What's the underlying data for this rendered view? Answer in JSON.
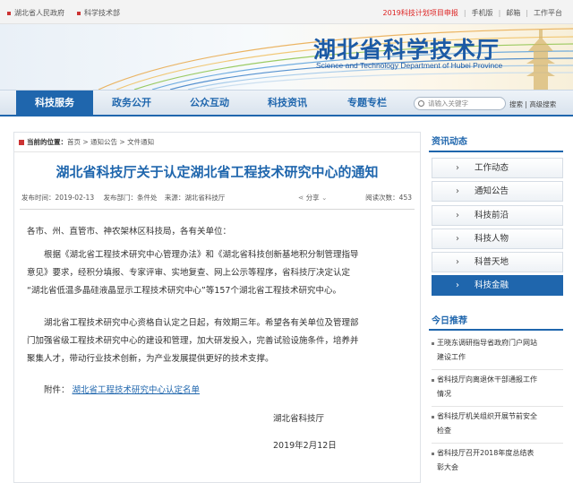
{
  "topbar": {
    "links_left": [
      "湖北省人民政府",
      "科学技术部"
    ],
    "notice": "2019科技计划项目申报",
    "links_right": [
      "手机版",
      "邮箱",
      "工作平台"
    ]
  },
  "banner": {
    "title": "湖北省科学技术厅",
    "subtitle": "Science and Technology Department of Hubei Province"
  },
  "nav": {
    "items": [
      "科技服务",
      "政务公开",
      "公众互动",
      "科技资讯",
      "专题专栏"
    ],
    "search_placeholder": "请输入关键字",
    "search_label": "搜索",
    "advanced_label": "高级搜索"
  },
  "breadcrumb": {
    "prefix": "当前的位置：",
    "path": "首页 > 通知公告 > 文件通知"
  },
  "article": {
    "title": "湖北省科技厅关于认定湖北省工程技术研究中心的通知",
    "date": "发布时间：2019-02-13",
    "dept": "发布部门：条件处",
    "source": "来源：湖北省科技厅",
    "share": "分享",
    "views": "阅读次数：453",
    "salutation": "各市、州、直管市、神农架林区科技局，各有关单位：",
    "para1": [
      "根据《湖北省工程技术研究中心管理办法》和《湖北省科技创新基地积分制管理指导",
      "意见》要求，经积分填报、专家评审、实地复查、网上公示等程序，省科技厅决定认定",
      "“湖北省低温多晶硅液晶显示工程技术研究中心”等157个湖北省工程技术研究中心。"
    ],
    "para2": [
      "湖北省工程技术研究中心资格自认定之日起，有效期三年。希望各有关单位及管理部",
      "门加强省级工程技术研究中心的建设和管理，加大研发投入，完善试验设施条件，培养并",
      "聚集人才，带动行业技术创新，为产业发展提供更好的技术支撑。"
    ],
    "attach_label": "附件：",
    "attach_link": "湖北省工程技术研究中心认定名单",
    "sign_org": "湖北省科技厅",
    "sign_date": "2019年2月12日"
  },
  "sidebar": {
    "heading": "资讯动态",
    "items": [
      "工作动态",
      "通知公告",
      "科技前沿",
      "科技人物",
      "科普天地",
      "科技金融"
    ],
    "active_index": 5
  },
  "today": {
    "heading": "今日推荐",
    "news": [
      [
        "王晓东调研指导省政府门户网站",
        "建设工作"
      ],
      [
        "省科技厅向离退休干部通报工作",
        "情况"
      ],
      [
        "省科技厅机关组织开展节前安全",
        "检查"
      ],
      [
        "省科技厅召开2018年度总结表",
        "彰大会"
      ]
    ]
  },
  "colors": {
    "brand_blue": "#1f66ad",
    "notice_red": "#d22222"
  }
}
